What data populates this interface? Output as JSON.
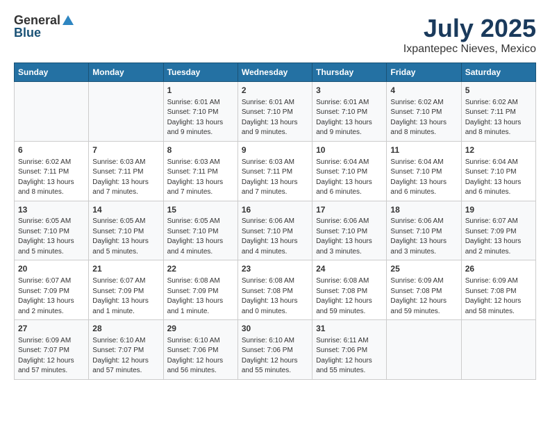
{
  "header": {
    "logo": {
      "general": "General",
      "blue": "Blue"
    },
    "month": "July 2025",
    "location": "Ixpantepec Nieves, Mexico"
  },
  "weekdays": [
    "Sunday",
    "Monday",
    "Tuesday",
    "Wednesday",
    "Thursday",
    "Friday",
    "Saturday"
  ],
  "weeks": [
    [
      {
        "day": "",
        "info": ""
      },
      {
        "day": "",
        "info": ""
      },
      {
        "day": "1",
        "info": "Sunrise: 6:01 AM\nSunset: 7:10 PM\nDaylight: 13 hours and 9 minutes."
      },
      {
        "day": "2",
        "info": "Sunrise: 6:01 AM\nSunset: 7:10 PM\nDaylight: 13 hours and 9 minutes."
      },
      {
        "day": "3",
        "info": "Sunrise: 6:01 AM\nSunset: 7:10 PM\nDaylight: 13 hours and 9 minutes."
      },
      {
        "day": "4",
        "info": "Sunrise: 6:02 AM\nSunset: 7:10 PM\nDaylight: 13 hours and 8 minutes."
      },
      {
        "day": "5",
        "info": "Sunrise: 6:02 AM\nSunset: 7:11 PM\nDaylight: 13 hours and 8 minutes."
      }
    ],
    [
      {
        "day": "6",
        "info": "Sunrise: 6:02 AM\nSunset: 7:11 PM\nDaylight: 13 hours and 8 minutes."
      },
      {
        "day": "7",
        "info": "Sunrise: 6:03 AM\nSunset: 7:11 PM\nDaylight: 13 hours and 7 minutes."
      },
      {
        "day": "8",
        "info": "Sunrise: 6:03 AM\nSunset: 7:11 PM\nDaylight: 13 hours and 7 minutes."
      },
      {
        "day": "9",
        "info": "Sunrise: 6:03 AM\nSunset: 7:11 PM\nDaylight: 13 hours and 7 minutes."
      },
      {
        "day": "10",
        "info": "Sunrise: 6:04 AM\nSunset: 7:10 PM\nDaylight: 13 hours and 6 minutes."
      },
      {
        "day": "11",
        "info": "Sunrise: 6:04 AM\nSunset: 7:10 PM\nDaylight: 13 hours and 6 minutes."
      },
      {
        "day": "12",
        "info": "Sunrise: 6:04 AM\nSunset: 7:10 PM\nDaylight: 13 hours and 6 minutes."
      }
    ],
    [
      {
        "day": "13",
        "info": "Sunrise: 6:05 AM\nSunset: 7:10 PM\nDaylight: 13 hours and 5 minutes."
      },
      {
        "day": "14",
        "info": "Sunrise: 6:05 AM\nSunset: 7:10 PM\nDaylight: 13 hours and 5 minutes."
      },
      {
        "day": "15",
        "info": "Sunrise: 6:05 AM\nSunset: 7:10 PM\nDaylight: 13 hours and 4 minutes."
      },
      {
        "day": "16",
        "info": "Sunrise: 6:06 AM\nSunset: 7:10 PM\nDaylight: 13 hours and 4 minutes."
      },
      {
        "day": "17",
        "info": "Sunrise: 6:06 AM\nSunset: 7:10 PM\nDaylight: 13 hours and 3 minutes."
      },
      {
        "day": "18",
        "info": "Sunrise: 6:06 AM\nSunset: 7:10 PM\nDaylight: 13 hours and 3 minutes."
      },
      {
        "day": "19",
        "info": "Sunrise: 6:07 AM\nSunset: 7:09 PM\nDaylight: 13 hours and 2 minutes."
      }
    ],
    [
      {
        "day": "20",
        "info": "Sunrise: 6:07 AM\nSunset: 7:09 PM\nDaylight: 13 hours and 2 minutes."
      },
      {
        "day": "21",
        "info": "Sunrise: 6:07 AM\nSunset: 7:09 PM\nDaylight: 13 hours and 1 minute."
      },
      {
        "day": "22",
        "info": "Sunrise: 6:08 AM\nSunset: 7:09 PM\nDaylight: 13 hours and 1 minute."
      },
      {
        "day": "23",
        "info": "Sunrise: 6:08 AM\nSunset: 7:08 PM\nDaylight: 13 hours and 0 minutes."
      },
      {
        "day": "24",
        "info": "Sunrise: 6:08 AM\nSunset: 7:08 PM\nDaylight: 12 hours and 59 minutes."
      },
      {
        "day": "25",
        "info": "Sunrise: 6:09 AM\nSunset: 7:08 PM\nDaylight: 12 hours and 59 minutes."
      },
      {
        "day": "26",
        "info": "Sunrise: 6:09 AM\nSunset: 7:08 PM\nDaylight: 12 hours and 58 minutes."
      }
    ],
    [
      {
        "day": "27",
        "info": "Sunrise: 6:09 AM\nSunset: 7:07 PM\nDaylight: 12 hours and 57 minutes."
      },
      {
        "day": "28",
        "info": "Sunrise: 6:10 AM\nSunset: 7:07 PM\nDaylight: 12 hours and 57 minutes."
      },
      {
        "day": "29",
        "info": "Sunrise: 6:10 AM\nSunset: 7:06 PM\nDaylight: 12 hours and 56 minutes."
      },
      {
        "day": "30",
        "info": "Sunrise: 6:10 AM\nSunset: 7:06 PM\nDaylight: 12 hours and 55 minutes."
      },
      {
        "day": "31",
        "info": "Sunrise: 6:11 AM\nSunset: 7:06 PM\nDaylight: 12 hours and 55 minutes."
      },
      {
        "day": "",
        "info": ""
      },
      {
        "day": "",
        "info": ""
      }
    ]
  ]
}
